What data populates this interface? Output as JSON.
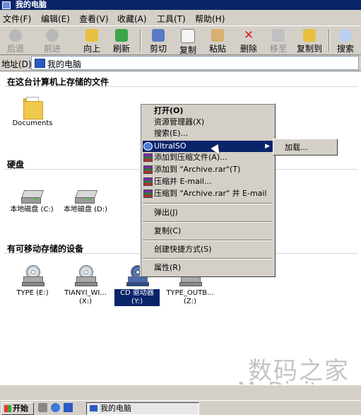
{
  "window": {
    "title": "我的电脑"
  },
  "menubar": [
    "文件(F)",
    "编辑(E)",
    "查看(V)",
    "收藏(A)",
    "工具(T)",
    "帮助(H)"
  ],
  "toolbar": {
    "back": "后退",
    "forward": "前进",
    "up": "向上",
    "refresh": "刷新",
    "cut": "剪切",
    "copy": "复制",
    "paste": "粘贴",
    "delete": "删除",
    "move_to": "移至",
    "copy_to": "复制到",
    "search": "搜索"
  },
  "address": {
    "label": "地址(D)",
    "value": "我的电脑"
  },
  "sections": {
    "stored_files": "在这台计算机上存储的文件",
    "hard_disks": "硬盘",
    "removable": "有可移动存储的设备"
  },
  "items": {
    "documents": "Documents",
    "disk_c": "本地磁盘 (C:)",
    "disk_d": "本地磁盘 (D:)",
    "type_e": "TYPE (E:)",
    "tianyi_name": "TIANYI_WI...",
    "tianyi_drive": "(X:)",
    "cd_name": "CD 驱动器",
    "cd_drive": "(Y:)",
    "outb_name": "TYPE_OUTB...",
    "outb_drive": "(Z:)"
  },
  "context_menu": {
    "open": "打开(O)",
    "explorer": "资源管理器(X)",
    "search": "搜索(E)...",
    "ultraiso": "UltraISO",
    "add_archive": "添加到压缩文件(A)...",
    "add_rar": "添加到 \"Archive.rar\"(T)",
    "compress_email": "压缩并 E-mail...",
    "compress_rar_email": "压缩到 \"Archive.rar\" 并 E-mail",
    "eject": "弹出(J)",
    "copy": "复制(C)",
    "shortcut": "创建快捷方式(S)",
    "properties": "属性(R)"
  },
  "submenu": {
    "load": "加载..."
  },
  "taskbar": {
    "start": "开始",
    "task": "我的电脑"
  },
  "watermark": {
    "line1": "数码之家",
    "line2": "MyDigit.cn"
  }
}
